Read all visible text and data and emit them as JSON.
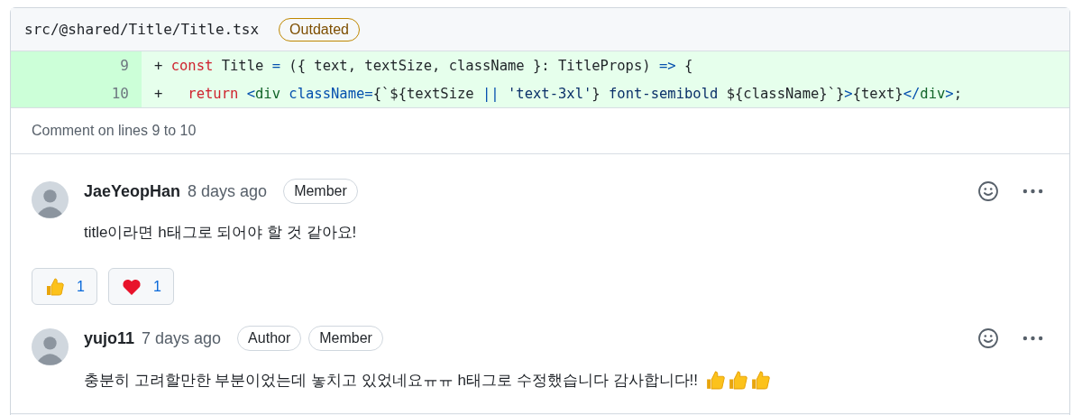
{
  "file": {
    "path": "src/@shared/Title/Title.tsx",
    "badge": "Outdated"
  },
  "code_lines": [
    {
      "number": "9",
      "tokens": [
        {
          "kind": "plain",
          "text": "+ "
        },
        {
          "kind": "keyword",
          "text": "const"
        },
        {
          "kind": "plain",
          "text": " Title "
        },
        {
          "kind": "operator",
          "text": "="
        },
        {
          "kind": "plain",
          "text": " ({ text, textSize, className }: TitleProps) "
        },
        {
          "kind": "operator",
          "text": "=>"
        },
        {
          "kind": "plain",
          "text": " {"
        }
      ]
    },
    {
      "number": "10",
      "tokens": [
        {
          "kind": "plain",
          "text": "+   "
        },
        {
          "kind": "keyword",
          "text": "return "
        },
        {
          "kind": "operator",
          "text": "<"
        },
        {
          "kind": "tag",
          "text": "div "
        },
        {
          "kind": "operator",
          "text": "className="
        },
        {
          "kind": "plain",
          "text": "{`${textSize "
        },
        {
          "kind": "operator",
          "text": "|| "
        },
        {
          "kind": "string",
          "text": "'text-3xl'"
        },
        {
          "kind": "plain",
          "text": "} "
        },
        {
          "kind": "string",
          "text": "font-semibold"
        },
        {
          "kind": "plain",
          "text": " ${className}`}"
        },
        {
          "kind": "operator",
          "text": ">"
        },
        {
          "kind": "plain",
          "text": "{text}"
        },
        {
          "kind": "operator",
          "text": "</"
        },
        {
          "kind": "tag",
          "text": "div"
        },
        {
          "kind": "operator",
          "text": ">"
        },
        {
          "kind": "plain",
          "text": ";"
        }
      ]
    }
  ],
  "comment_range": "Comment on lines 9 to 10",
  "comments": [
    {
      "author": "JaeYeopHan",
      "time": "8 days ago",
      "badges": [
        "Member"
      ],
      "body": "title이라면 h태그로 되어야 할 것 같아요!",
      "reactions": [
        {
          "kind": "thumbs_up",
          "count": "1"
        },
        {
          "kind": "heart",
          "count": "1"
        }
      ]
    },
    {
      "author": "yujo11",
      "time": "7 days ago",
      "badges": [
        "Author",
        "Member"
      ],
      "body": "충분히 고려할만한 부분이었는데 놓치고 있었네요ㅠㅠ h태그로 수정했습니다 감사합니다!!",
      "trailing_emoji": [
        {
          "kind": "thumbs_up"
        },
        {
          "kind": "thumbs_up"
        },
        {
          "kind": "thumbs_up"
        }
      ]
    }
  ]
}
